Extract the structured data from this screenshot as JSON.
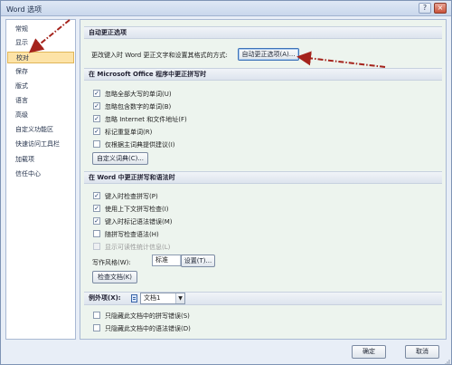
{
  "window": {
    "title": "Word 选项",
    "help_icon": "?",
    "close_icon": "×"
  },
  "sidebar": {
    "items": [
      {
        "label": "常规"
      },
      {
        "label": "显示"
      },
      {
        "label": "校对",
        "selected": true
      },
      {
        "label": "保存"
      },
      {
        "label": "版式"
      },
      {
        "label": "语言"
      },
      {
        "label": "高级"
      },
      {
        "label": "自定义功能区"
      },
      {
        "label": "快速访问工具栏"
      },
      {
        "label": "加载项"
      },
      {
        "label": "信任中心"
      }
    ]
  },
  "autocorrect": {
    "header": "自动更正选项",
    "description": "更改键入时 Word 更正文字和设置其格式的方式:",
    "button_label": "自动更正选项(A)..."
  },
  "office_spelling": {
    "header": "在 Microsoft Office 程序中更正拼写时",
    "options": [
      {
        "label": "忽略全部大写的单词(U)",
        "checked": true,
        "enabled": true
      },
      {
        "label": "忽略包含数字的单词(B)",
        "checked": true,
        "enabled": true
      },
      {
        "label": "忽略 Internet 和文件地址(F)",
        "checked": true,
        "enabled": true
      },
      {
        "label": "标记重复单词(R)",
        "checked": true,
        "enabled": true
      },
      {
        "label": "仅根据主词典提供建议(I)",
        "checked": false,
        "enabled": true
      }
    ],
    "dictionary_button": "自定义词典(C)..."
  },
  "word_spelling": {
    "header": "在 Word 中更正拼写和语法时",
    "options": [
      {
        "label": "键入时检查拼写(P)",
        "checked": true,
        "enabled": true
      },
      {
        "label": "使用上下文拼写检查(I)",
        "checked": true,
        "enabled": true
      },
      {
        "label": "键入时标记语法错误(M)",
        "checked": true,
        "enabled": true
      },
      {
        "label": "随拼写检查语法(H)",
        "checked": false,
        "enabled": true
      },
      {
        "label": "显示可读性统计信息(L)",
        "checked": false,
        "enabled": false
      }
    ],
    "writing_style_label": "写作风格(W):",
    "writing_style_value": "标准",
    "settings_button": "设置(T)...",
    "check_document_button": "检查文档(K)"
  },
  "exceptions": {
    "label": "例外项(X):",
    "document_value": "文档1",
    "options": [
      {
        "label": "只隐藏此文档中的拼写错误(S)",
        "checked": false,
        "enabled": true
      },
      {
        "label": "只隐藏此文档中的语法错误(D)",
        "checked": false,
        "enabled": true
      }
    ]
  },
  "footer": {
    "ok_label": "确定",
    "cancel_label": "取消"
  },
  "annotation": {
    "arrow_color": "#a5231c"
  }
}
